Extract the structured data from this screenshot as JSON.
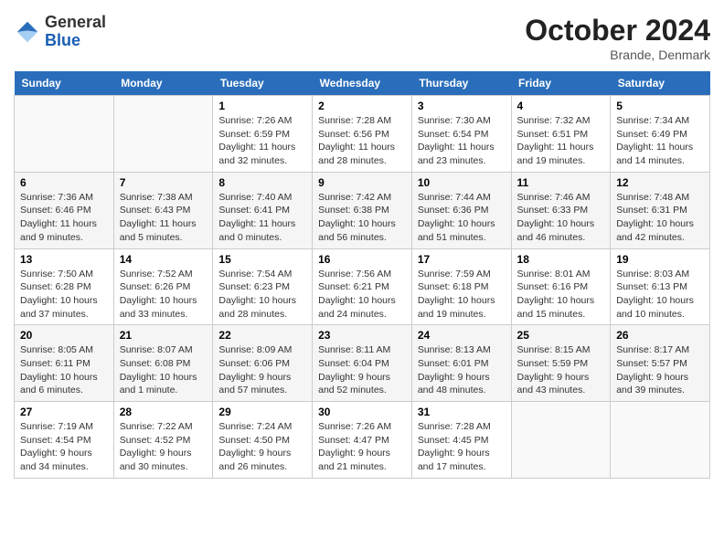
{
  "header": {
    "logo_line1": "General",
    "logo_line2": "Blue",
    "month_title": "October 2024",
    "location": "Brande, Denmark"
  },
  "days_of_week": [
    "Sunday",
    "Monday",
    "Tuesday",
    "Wednesday",
    "Thursday",
    "Friday",
    "Saturday"
  ],
  "weeks": [
    [
      {
        "day": "",
        "sunrise": "",
        "sunset": "",
        "daylight": ""
      },
      {
        "day": "",
        "sunrise": "",
        "sunset": "",
        "daylight": ""
      },
      {
        "day": "1",
        "sunrise": "Sunrise: 7:26 AM",
        "sunset": "Sunset: 6:59 PM",
        "daylight": "Daylight: 11 hours and 32 minutes."
      },
      {
        "day": "2",
        "sunrise": "Sunrise: 7:28 AM",
        "sunset": "Sunset: 6:56 PM",
        "daylight": "Daylight: 11 hours and 28 minutes."
      },
      {
        "day": "3",
        "sunrise": "Sunrise: 7:30 AM",
        "sunset": "Sunset: 6:54 PM",
        "daylight": "Daylight: 11 hours and 23 minutes."
      },
      {
        "day": "4",
        "sunrise": "Sunrise: 7:32 AM",
        "sunset": "Sunset: 6:51 PM",
        "daylight": "Daylight: 11 hours and 19 minutes."
      },
      {
        "day": "5",
        "sunrise": "Sunrise: 7:34 AM",
        "sunset": "Sunset: 6:49 PM",
        "daylight": "Daylight: 11 hours and 14 minutes."
      }
    ],
    [
      {
        "day": "6",
        "sunrise": "Sunrise: 7:36 AM",
        "sunset": "Sunset: 6:46 PM",
        "daylight": "Daylight: 11 hours and 9 minutes."
      },
      {
        "day": "7",
        "sunrise": "Sunrise: 7:38 AM",
        "sunset": "Sunset: 6:43 PM",
        "daylight": "Daylight: 11 hours and 5 minutes."
      },
      {
        "day": "8",
        "sunrise": "Sunrise: 7:40 AM",
        "sunset": "Sunset: 6:41 PM",
        "daylight": "Daylight: 11 hours and 0 minutes."
      },
      {
        "day": "9",
        "sunrise": "Sunrise: 7:42 AM",
        "sunset": "Sunset: 6:38 PM",
        "daylight": "Daylight: 10 hours and 56 minutes."
      },
      {
        "day": "10",
        "sunrise": "Sunrise: 7:44 AM",
        "sunset": "Sunset: 6:36 PM",
        "daylight": "Daylight: 10 hours and 51 minutes."
      },
      {
        "day": "11",
        "sunrise": "Sunrise: 7:46 AM",
        "sunset": "Sunset: 6:33 PM",
        "daylight": "Daylight: 10 hours and 46 minutes."
      },
      {
        "day": "12",
        "sunrise": "Sunrise: 7:48 AM",
        "sunset": "Sunset: 6:31 PM",
        "daylight": "Daylight: 10 hours and 42 minutes."
      }
    ],
    [
      {
        "day": "13",
        "sunrise": "Sunrise: 7:50 AM",
        "sunset": "Sunset: 6:28 PM",
        "daylight": "Daylight: 10 hours and 37 minutes."
      },
      {
        "day": "14",
        "sunrise": "Sunrise: 7:52 AM",
        "sunset": "Sunset: 6:26 PM",
        "daylight": "Daylight: 10 hours and 33 minutes."
      },
      {
        "day": "15",
        "sunrise": "Sunrise: 7:54 AM",
        "sunset": "Sunset: 6:23 PM",
        "daylight": "Daylight: 10 hours and 28 minutes."
      },
      {
        "day": "16",
        "sunrise": "Sunrise: 7:56 AM",
        "sunset": "Sunset: 6:21 PM",
        "daylight": "Daylight: 10 hours and 24 minutes."
      },
      {
        "day": "17",
        "sunrise": "Sunrise: 7:59 AM",
        "sunset": "Sunset: 6:18 PM",
        "daylight": "Daylight: 10 hours and 19 minutes."
      },
      {
        "day": "18",
        "sunrise": "Sunrise: 8:01 AM",
        "sunset": "Sunset: 6:16 PM",
        "daylight": "Daylight: 10 hours and 15 minutes."
      },
      {
        "day": "19",
        "sunrise": "Sunrise: 8:03 AM",
        "sunset": "Sunset: 6:13 PM",
        "daylight": "Daylight: 10 hours and 10 minutes."
      }
    ],
    [
      {
        "day": "20",
        "sunrise": "Sunrise: 8:05 AM",
        "sunset": "Sunset: 6:11 PM",
        "daylight": "Daylight: 10 hours and 6 minutes."
      },
      {
        "day": "21",
        "sunrise": "Sunrise: 8:07 AM",
        "sunset": "Sunset: 6:08 PM",
        "daylight": "Daylight: 10 hours and 1 minute."
      },
      {
        "day": "22",
        "sunrise": "Sunrise: 8:09 AM",
        "sunset": "Sunset: 6:06 PM",
        "daylight": "Daylight: 9 hours and 57 minutes."
      },
      {
        "day": "23",
        "sunrise": "Sunrise: 8:11 AM",
        "sunset": "Sunset: 6:04 PM",
        "daylight": "Daylight: 9 hours and 52 minutes."
      },
      {
        "day": "24",
        "sunrise": "Sunrise: 8:13 AM",
        "sunset": "Sunset: 6:01 PM",
        "daylight": "Daylight: 9 hours and 48 minutes."
      },
      {
        "day": "25",
        "sunrise": "Sunrise: 8:15 AM",
        "sunset": "Sunset: 5:59 PM",
        "daylight": "Daylight: 9 hours and 43 minutes."
      },
      {
        "day": "26",
        "sunrise": "Sunrise: 8:17 AM",
        "sunset": "Sunset: 5:57 PM",
        "daylight": "Daylight: 9 hours and 39 minutes."
      }
    ],
    [
      {
        "day": "27",
        "sunrise": "Sunrise: 7:19 AM",
        "sunset": "Sunset: 4:54 PM",
        "daylight": "Daylight: 9 hours and 34 minutes."
      },
      {
        "day": "28",
        "sunrise": "Sunrise: 7:22 AM",
        "sunset": "Sunset: 4:52 PM",
        "daylight": "Daylight: 9 hours and 30 minutes."
      },
      {
        "day": "29",
        "sunrise": "Sunrise: 7:24 AM",
        "sunset": "Sunset: 4:50 PM",
        "daylight": "Daylight: 9 hours and 26 minutes."
      },
      {
        "day": "30",
        "sunrise": "Sunrise: 7:26 AM",
        "sunset": "Sunset: 4:47 PM",
        "daylight": "Daylight: 9 hours and 21 minutes."
      },
      {
        "day": "31",
        "sunrise": "Sunrise: 7:28 AM",
        "sunset": "Sunset: 4:45 PM",
        "daylight": "Daylight: 9 hours and 17 minutes."
      },
      {
        "day": "",
        "sunrise": "",
        "sunset": "",
        "daylight": ""
      },
      {
        "day": "",
        "sunrise": "",
        "sunset": "",
        "daylight": ""
      }
    ]
  ]
}
